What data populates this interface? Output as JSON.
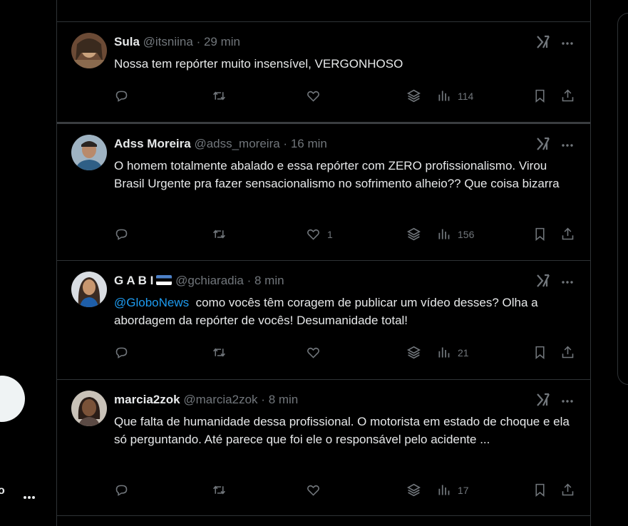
{
  "left_nav": {
    "partial_label": "o"
  },
  "posts": [
    {
      "name": "Sula",
      "handle": "@itsniina",
      "separator": "·",
      "time": "29 min",
      "text": "Nossa tem repórter muito insensível, VERGONHOSO",
      "likes": "",
      "views": "114"
    },
    {
      "name": "Adss Moreira",
      "handle": "@adss_moreira",
      "separator": "·",
      "time": "16 min",
      "text": "O homem totalmente abalado e essa repórter com ZERO profissionalismo. Virou Brasil Urgente pra fazer sensacionalismo no sofrimento alheio?? Que coisa bizarra",
      "likes": "1",
      "views": "156"
    },
    {
      "name": "G A B I",
      "handle": "@gchiaradia",
      "separator": "·",
      "time": "8 min",
      "mention": "@GloboNews",
      "text": "  como vocês têm coragem de publicar um vídeo desses? Olha a abordagem da repórter de vocês! Desumanidade total!",
      "likes": "",
      "views": "21"
    },
    {
      "name": "marcia2zok",
      "handle": "@marcia2zok",
      "separator": "·",
      "time": "8 min",
      "text": "Que falta de humanidade dessa profissional. O motorista em estado de choque e ela só perguntando. Até parece que foi ele o responsável pelo acidente ...",
      "likes": "",
      "views": "17"
    }
  ],
  "colors": {
    "background": "#000000",
    "text": "#e7e9ea",
    "muted": "#71767b",
    "link": "#1d9bf0",
    "border": "#2f3336"
  }
}
